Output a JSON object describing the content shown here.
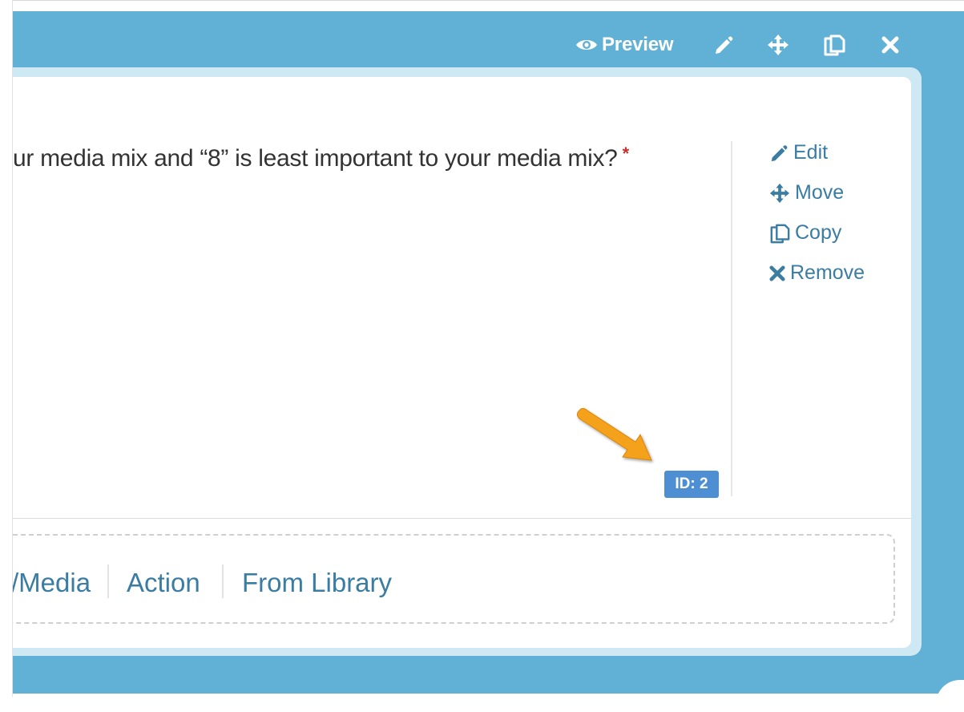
{
  "toolbar": {
    "preview_label": "Preview",
    "icons": [
      "eye-icon",
      "pencil-icon",
      "move-icon",
      "copy-icon",
      "close-icon"
    ]
  },
  "question": {
    "text": "ur media mix and “8” is least important to your media mix?",
    "required_marker": "*"
  },
  "side_actions": {
    "edit": "Edit",
    "move": "Move",
    "copy": "Copy",
    "remove": "Remove"
  },
  "id_badge": "ID: 2",
  "add_bar": {
    "items": [
      "/Media",
      "Action",
      "From Library"
    ]
  },
  "colors": {
    "background": "#61b0d5",
    "link": "#3a7ca2",
    "badge": "#4e8fd4",
    "arrow": "#f4a11a",
    "required": "#c9302c"
  }
}
